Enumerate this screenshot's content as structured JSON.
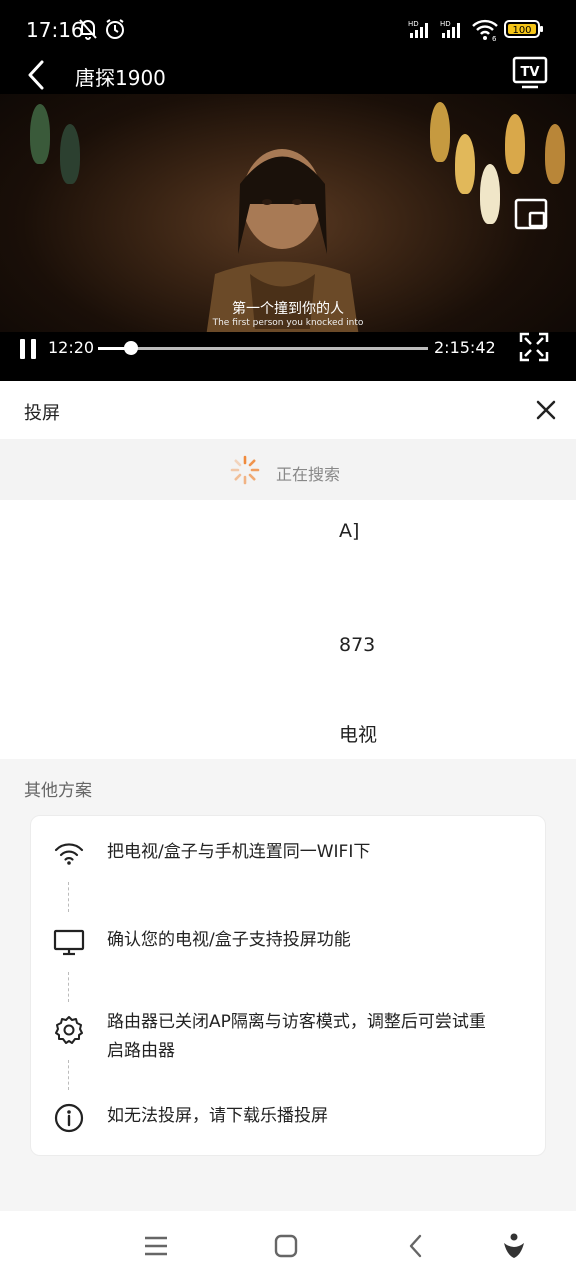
{
  "status": {
    "time": "17:16",
    "battery": "100",
    "signal1_label": "HD",
    "signal2_label": "HD",
    "wifi_sub": "6"
  },
  "titlebar": {
    "title": "唐探1900"
  },
  "video": {
    "subtitle_cn": "第一个撞到你的人",
    "subtitle_en": "The first person you knocked into",
    "current_time": "12:20",
    "total_time": "2:15:42",
    "progress": 0.1
  },
  "cast": {
    "title": "投屏",
    "searching": "正在搜索",
    "devices": [
      {
        "name": "A]"
      },
      {
        "name": "873"
      },
      {
        "name": "电视"
      }
    ]
  },
  "others": {
    "title": "其他方案",
    "steps": [
      {
        "icon": "wifi-icon",
        "text": "把电视/盒子与手机连置同一WIFI下"
      },
      {
        "icon": "monitor-icon",
        "text": "确认您的电视/盒子支持投屏功能"
      },
      {
        "icon": "gear-icon",
        "text": "路由器已关闭AP隔离与访客模式，调整后可尝试重启路由器"
      },
      {
        "icon": "info-icon",
        "text": "如无法投屏，请下载乐播投屏"
      }
    ]
  },
  "navbar": {
    "items": [
      "menu-icon",
      "home-icon",
      "back-icon",
      "assistant-icon"
    ]
  }
}
